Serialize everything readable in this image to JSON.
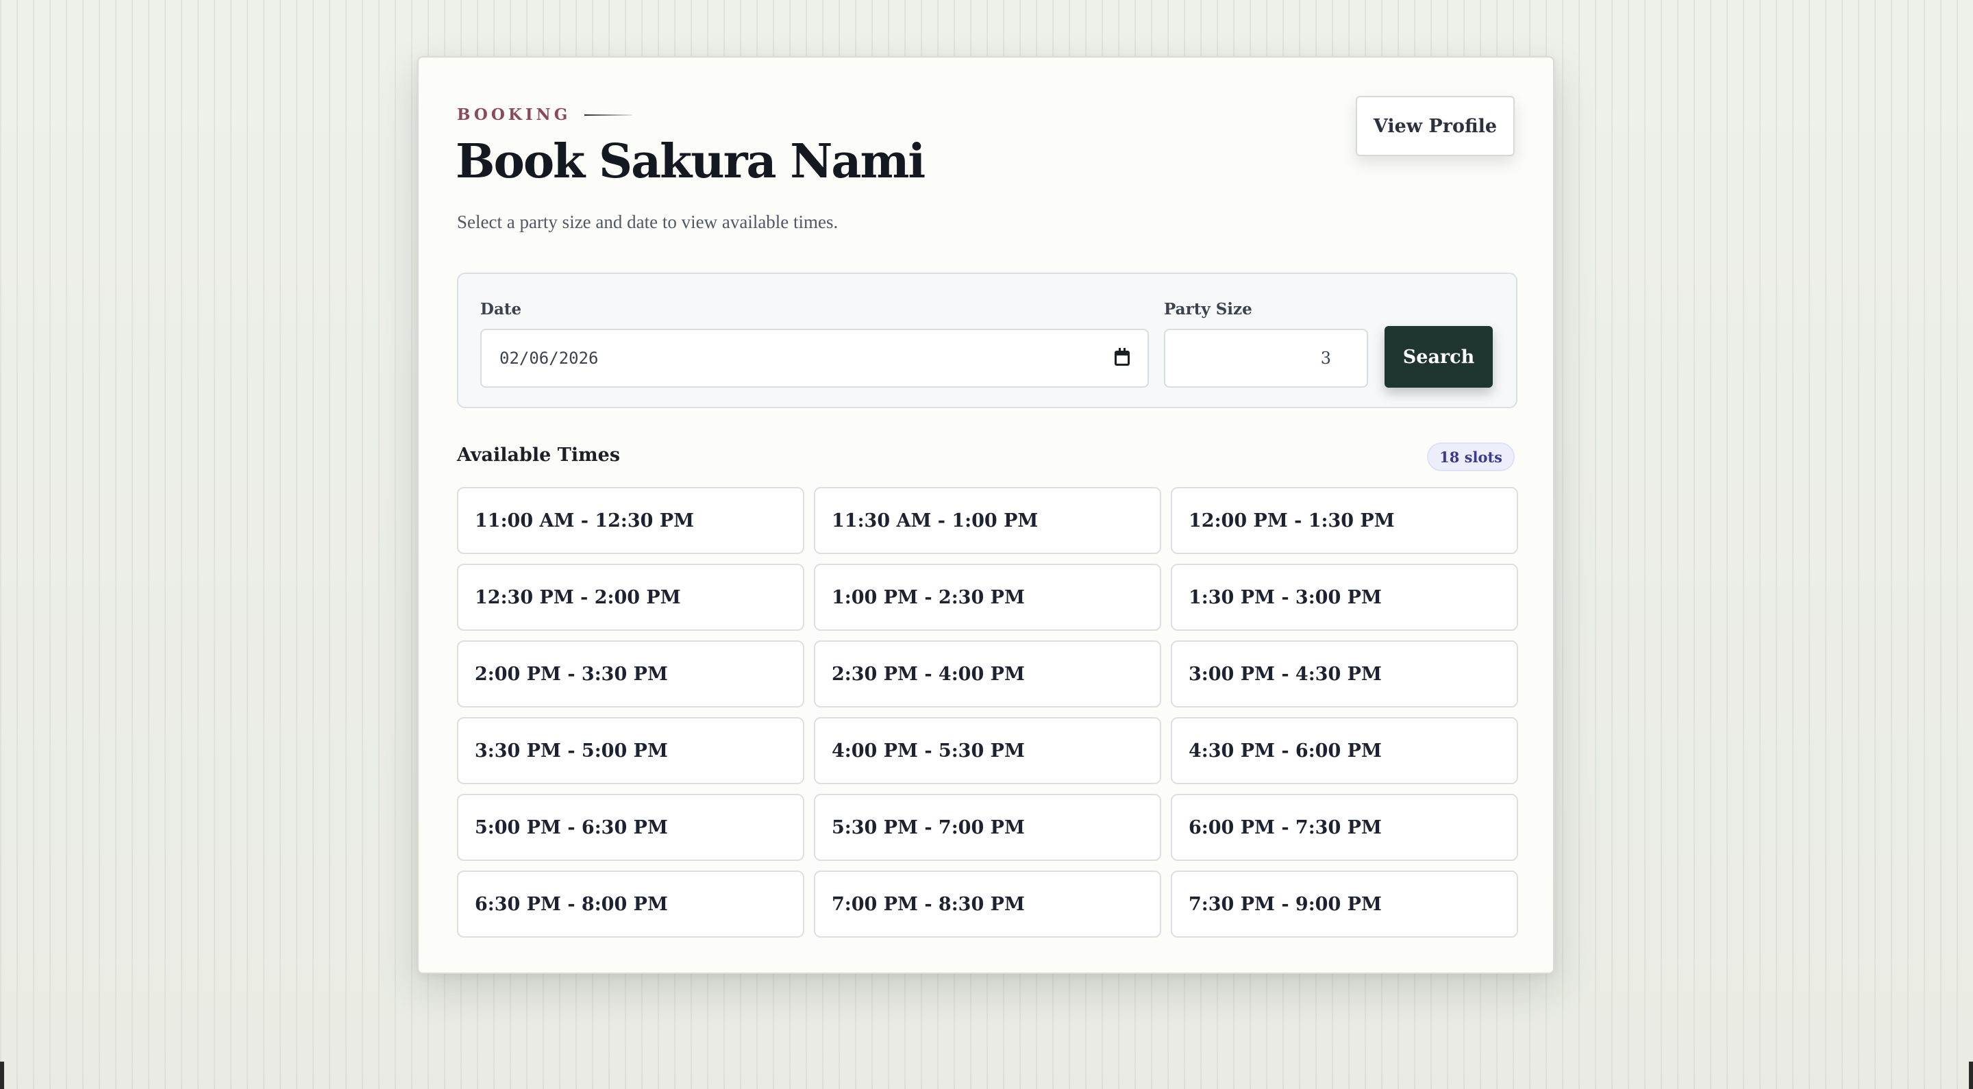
{
  "eyebrow": "BOOKING",
  "title": "Book Sakura Nami",
  "subtitle": "Select a party size and date to view available times.",
  "header": {
    "view_profile_label": "View Profile"
  },
  "search": {
    "date_label": "Date",
    "date_value": "02/06/2026",
    "party_label": "Party Size",
    "party_value": "3",
    "search_label": "Search"
  },
  "availability": {
    "title": "Available Times",
    "count_badge": "18 slots",
    "slots": [
      "11:00 AM - 12:30 PM",
      "11:30 AM - 1:00 PM",
      "12:00 PM - 1:30 PM",
      "12:30 PM - 2:00 PM",
      "1:00 PM - 2:30 PM",
      "1:30 PM - 3:00 PM",
      "2:00 PM - 3:30 PM",
      "2:30 PM - 4:00 PM",
      "3:00 PM - 4:30 PM",
      "3:30 PM - 5:00 PM",
      "4:00 PM - 5:30 PM",
      "4:30 PM - 6:00 PM",
      "5:00 PM - 6:30 PM",
      "5:30 PM - 7:00 PM",
      "6:00 PM - 7:30 PM",
      "6:30 PM - 8:00 PM",
      "7:00 PM - 8:30 PM",
      "7:30 PM - 9:00 PM"
    ]
  },
  "colors": {
    "accent_eyebrow": "#8b4a5a",
    "primary_button": "#1f3530",
    "badge_text": "#3d3a8f"
  }
}
